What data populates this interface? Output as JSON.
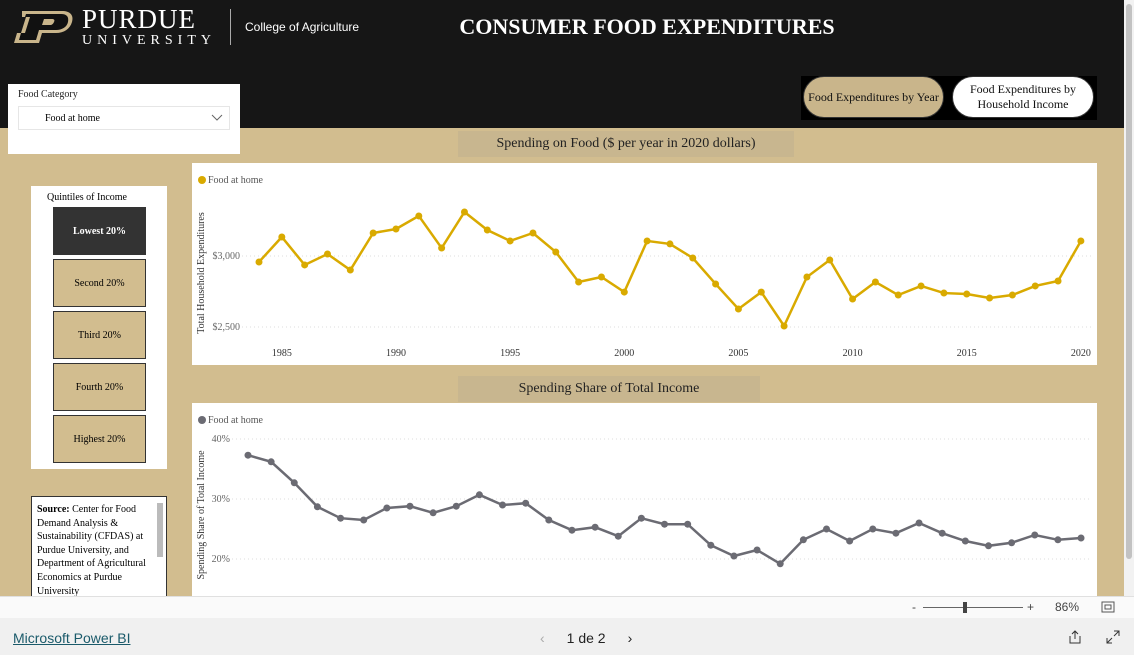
{
  "header": {
    "logo_line1": "PURDUE",
    "logo_line2": "UNIVERSITY",
    "college": "College of Agriculture",
    "title": "CONSUMER FOOD EXPENDITURES"
  },
  "nav": {
    "by_year": "Food Expenditures by Year",
    "by_income": "Food Expenditures by Household Income"
  },
  "slicer": {
    "label": "Food Category",
    "value": "Food at home"
  },
  "quintiles": {
    "label": "Quintiles of Income",
    "items": [
      "Lowest 20%",
      "Second 20%",
      "Third 20%",
      "Fourth 20%",
      "Highest 20%"
    ],
    "selected": "Lowest 20%"
  },
  "source": {
    "label": "Source:",
    "text": "Center for Food Demand Analysis & Sustainability (CFDAS) at Purdue University, and Department of Agricultural Economics at Purdue University"
  },
  "colors": {
    "gold": "#d9aa00",
    "gray": "#6b6b73",
    "tan": "#d2bd8f",
    "black": "#161616"
  },
  "chart_data": [
    {
      "type": "line",
      "title": "Spending on Food ($ per year in 2020 dollars)",
      "ylabel": "Total Household Expenditures",
      "legend": "top-left",
      "grid": true,
      "series": [
        {
          "name": "Food at home",
          "color": "#d9aa00",
          "values": [
            2958,
            3134,
            2937,
            3014,
            2901,
            3162,
            3190,
            3282,
            3056,
            3310,
            3183,
            3106,
            3162,
            3028,
            2817,
            2852,
            2746,
            3106,
            3085,
            2986,
            2803,
            2627,
            2746,
            2507,
            2852,
            2972,
            2697,
            2817,
            2725,
            2789,
            2739,
            2732,
            2704,
            2725,
            2789,
            2824,
            3106
          ]
        }
      ],
      "x": [
        1984,
        1985,
        1986,
        1987,
        1988,
        1989,
        1990,
        1991,
        1992,
        1993,
        1994,
        1995,
        1996,
        1997,
        1998,
        1999,
        2000,
        2001,
        2002,
        2003,
        2004,
        2005,
        2006,
        2007,
        2008,
        2009,
        2010,
        2011,
        2012,
        2013,
        2014,
        2015,
        2016,
        2017,
        2018,
        2019,
        2020
      ],
      "xticks": [
        "1985",
        "1990",
        "1995",
        "2000",
        "2005",
        "2010",
        "2015",
        "2020"
      ],
      "yticks": [
        "$2,500",
        "$3,000"
      ],
      "ylim": [
        2400,
        3420
      ],
      "xlim": [
        1983.3,
        2020.4
      ]
    },
    {
      "type": "line",
      "title": "Spending Share of Total Income",
      "ylabel": "Spending Share of Total Income",
      "legend": "top-left",
      "grid": true,
      "series": [
        {
          "name": "Food at home",
          "color": "#6b6b73",
          "values": [
            37.3,
            36.2,
            32.7,
            28.7,
            26.8,
            26.5,
            28.5,
            28.8,
            27.7,
            28.8,
            30.7,
            29.0,
            29.3,
            26.5,
            24.8,
            25.3,
            23.8,
            26.8,
            25.8,
            25.8,
            22.3,
            20.5,
            21.5,
            19.2,
            23.2,
            25.0,
            23.0,
            25.0,
            24.3,
            26.0,
            24.3,
            23.0,
            22.2,
            22.7,
            24.0,
            23.2,
            23.5
          ]
        }
      ],
      "x": [
        1984,
        1985,
        1986,
        1987,
        1988,
        1989,
        1990,
        1991,
        1992,
        1993,
        1994,
        1995,
        1996,
        1997,
        1998,
        1999,
        2000,
        2001,
        2002,
        2003,
        2004,
        2005,
        2006,
        2007,
        2008,
        2009,
        2010,
        2011,
        2012,
        2013,
        2014,
        2015,
        2016,
        2017,
        2018,
        2019,
        2020
      ],
      "yticks": [
        "20%",
        "30%",
        "40%"
      ],
      "ylim": [
        14,
        42
      ]
    }
  ],
  "footer": {
    "zoom_minus": "-",
    "zoom_plus": "+",
    "zoom": "86%",
    "powerbi": "Microsoft Power BI",
    "page": "1 de 2"
  }
}
